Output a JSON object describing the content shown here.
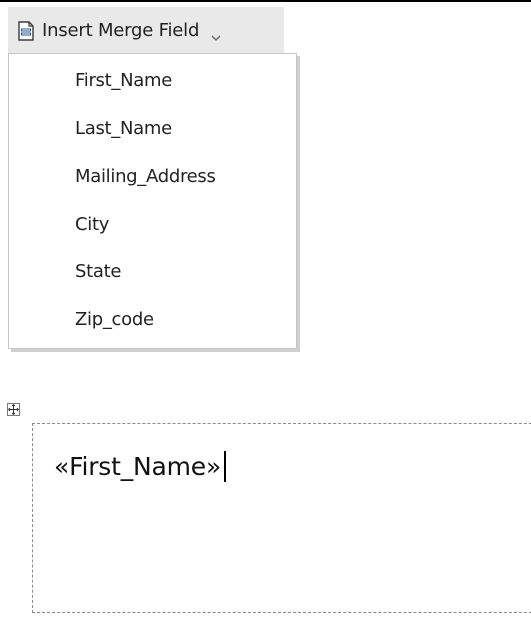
{
  "toolbar": {
    "insert_merge_field": {
      "label": "Insert Merge Field",
      "icon": "document-icon",
      "dropdown_icon": "chevron-down-icon"
    }
  },
  "merge_field_menu": {
    "items": [
      {
        "label": "First_Name"
      },
      {
        "label": "Last_Name"
      },
      {
        "label": "Mailing_Address"
      },
      {
        "label": "City"
      },
      {
        "label": "State"
      },
      {
        "label": "Zip_code"
      }
    ]
  },
  "document": {
    "move_handle_icon": "move-cross-icon",
    "text_box": {
      "content": "«First_Name»"
    }
  },
  "colors": {
    "button_background": "#e9e9e9",
    "menu_border": "#c6c6c6",
    "text": "#222222"
  }
}
